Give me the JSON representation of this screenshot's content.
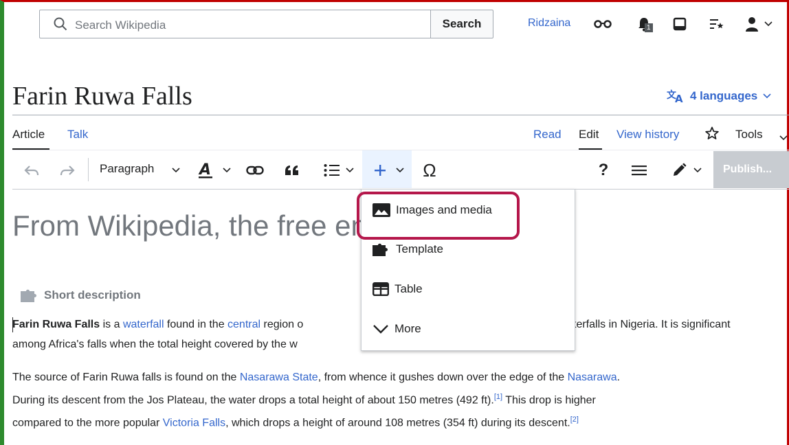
{
  "header": {
    "search_placeholder": "Search Wikipedia",
    "search_button": "Search",
    "username": "Ridzaina",
    "notice_count": "1"
  },
  "page": {
    "title": "Farin Ruwa Falls",
    "languages": "4 languages",
    "tagline": "From Wikipedia, the free encyclopedia"
  },
  "tabs": {
    "article": "Article",
    "talk": "Talk",
    "read": "Read",
    "edit": "Edit",
    "view_history": "View history",
    "tools": "Tools"
  },
  "toolbar": {
    "paragraph": "Paragraph",
    "help": "?",
    "publish": "Publish..."
  },
  "insert_menu": {
    "items": [
      "Images and media",
      "Template",
      "Table",
      "More"
    ]
  },
  "content": {
    "short_description": "Short description",
    "p1": {
      "bold": "Farin Ruwa Falls",
      "t1": " is a ",
      "l1": "waterfall",
      "t2": " found in the ",
      "l2": "central",
      "t3": " region o",
      "t4": "terfalls in Nigeria. It is significant",
      "line2": "among Africa's falls when the total height covered by the w"
    },
    "p2": {
      "t1": "The source of Farin Ruwa falls is found on the ",
      "l1": "Nasarawa State",
      "t2": ", from whence it gushes down over the edge of the ",
      "l2": "Nasarawa",
      "t3": ".",
      "line2": "During its descent from the Jos Plateau, the water drops a total height of about 150 metres (492 ft).",
      "ref1": "[1]",
      "line2b": " This drop is higher",
      "t4": "compared to the more popular ",
      "l3": "Victoria Falls",
      "t5": ", which drops a height of around 108 metres (354 ft) during its descent.",
      "ref2": "[2]"
    }
  },
  "colors": {
    "link": "#3366cc",
    "highlight": "#b5174b",
    "publish_bg": "#c8ccd1"
  }
}
